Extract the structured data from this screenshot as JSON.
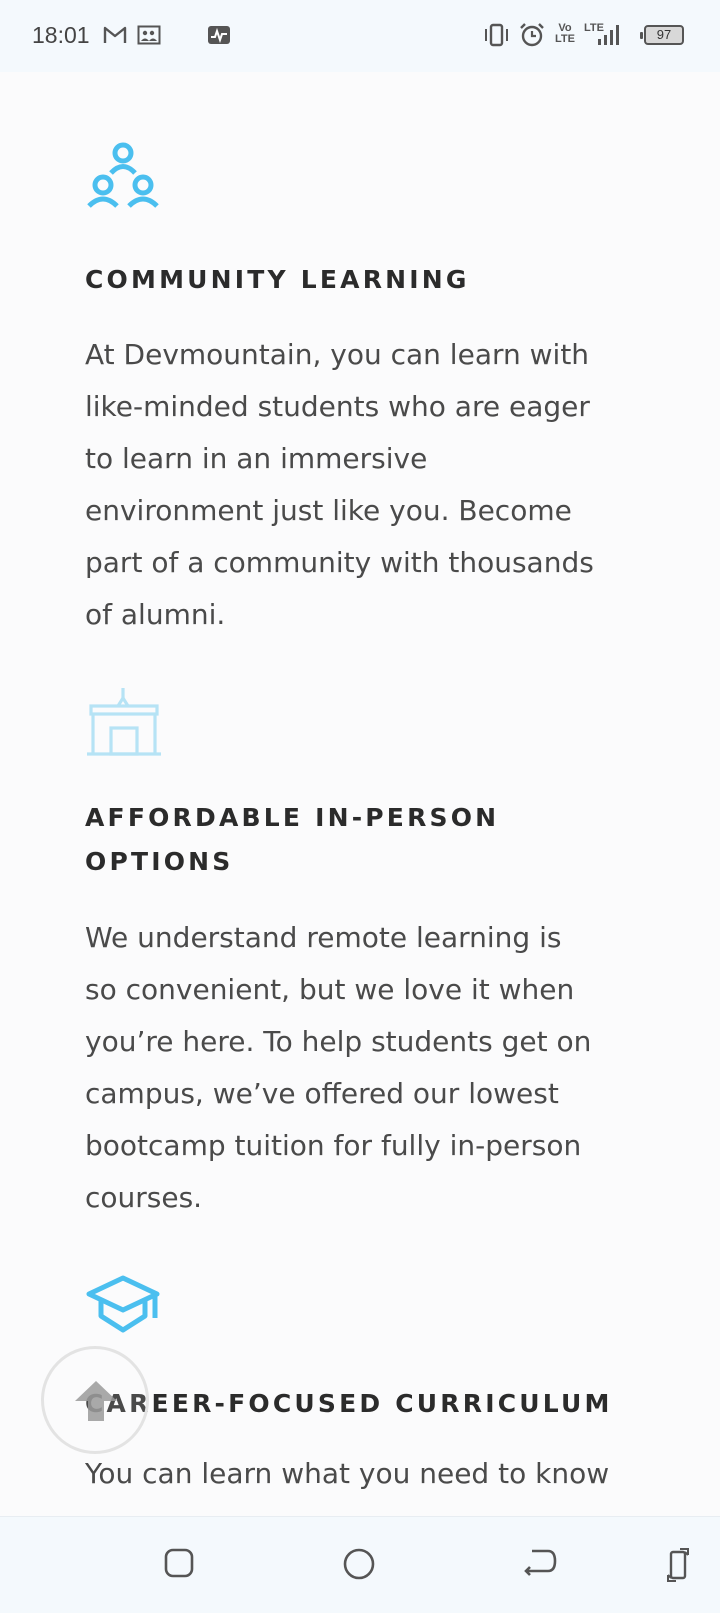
{
  "status_bar": {
    "time": "18:01",
    "left_icons": [
      "gmail-icon",
      "gallery-icon",
      "activity-icon"
    ],
    "right_icons": [
      "vibrate-icon",
      "alarm-icon",
      "volte-icon",
      "lte-signal-icon"
    ],
    "network_label_top": "Vo",
    "network_label_bottom": "LTE",
    "lte_label": "LTE",
    "battery_level": "97"
  },
  "features": [
    {
      "icon": "community-people-icon",
      "title": "COMMUNITY LEARNING",
      "body": "At Devmountain, you can learn with like-minded students who are eager to learn in an immersive environment just like you. Become part of a community with thousands of alumni."
    },
    {
      "icon": "campus-building-icon",
      "title": "AFFORDABLE IN-PERSON OPTIONS",
      "body": "We understand remote learning is so convenient, but we love it when you’re here. To help students get on campus, we’ve offered our lowest bootcamp tuition for fully in-person courses."
    },
    {
      "icon": "graduation-cap-icon",
      "title": "CAREER-FOCUSED CURRICULUM",
      "body": "You can learn what you need to know"
    }
  ],
  "scroll_top_button": {
    "icon": "arrow-up-icon"
  },
  "nav_bar": {
    "buttons": [
      "recent-apps-button",
      "home-button",
      "back-button",
      "rotate-button"
    ]
  },
  "colors": {
    "accent": "#4bbfef",
    "accent_faded": "#b6e3f5",
    "title_text": "#2b2b2b",
    "body_text": "#4a4a4a",
    "background": "#fbfbfc",
    "bars": "#f4f9fd"
  }
}
